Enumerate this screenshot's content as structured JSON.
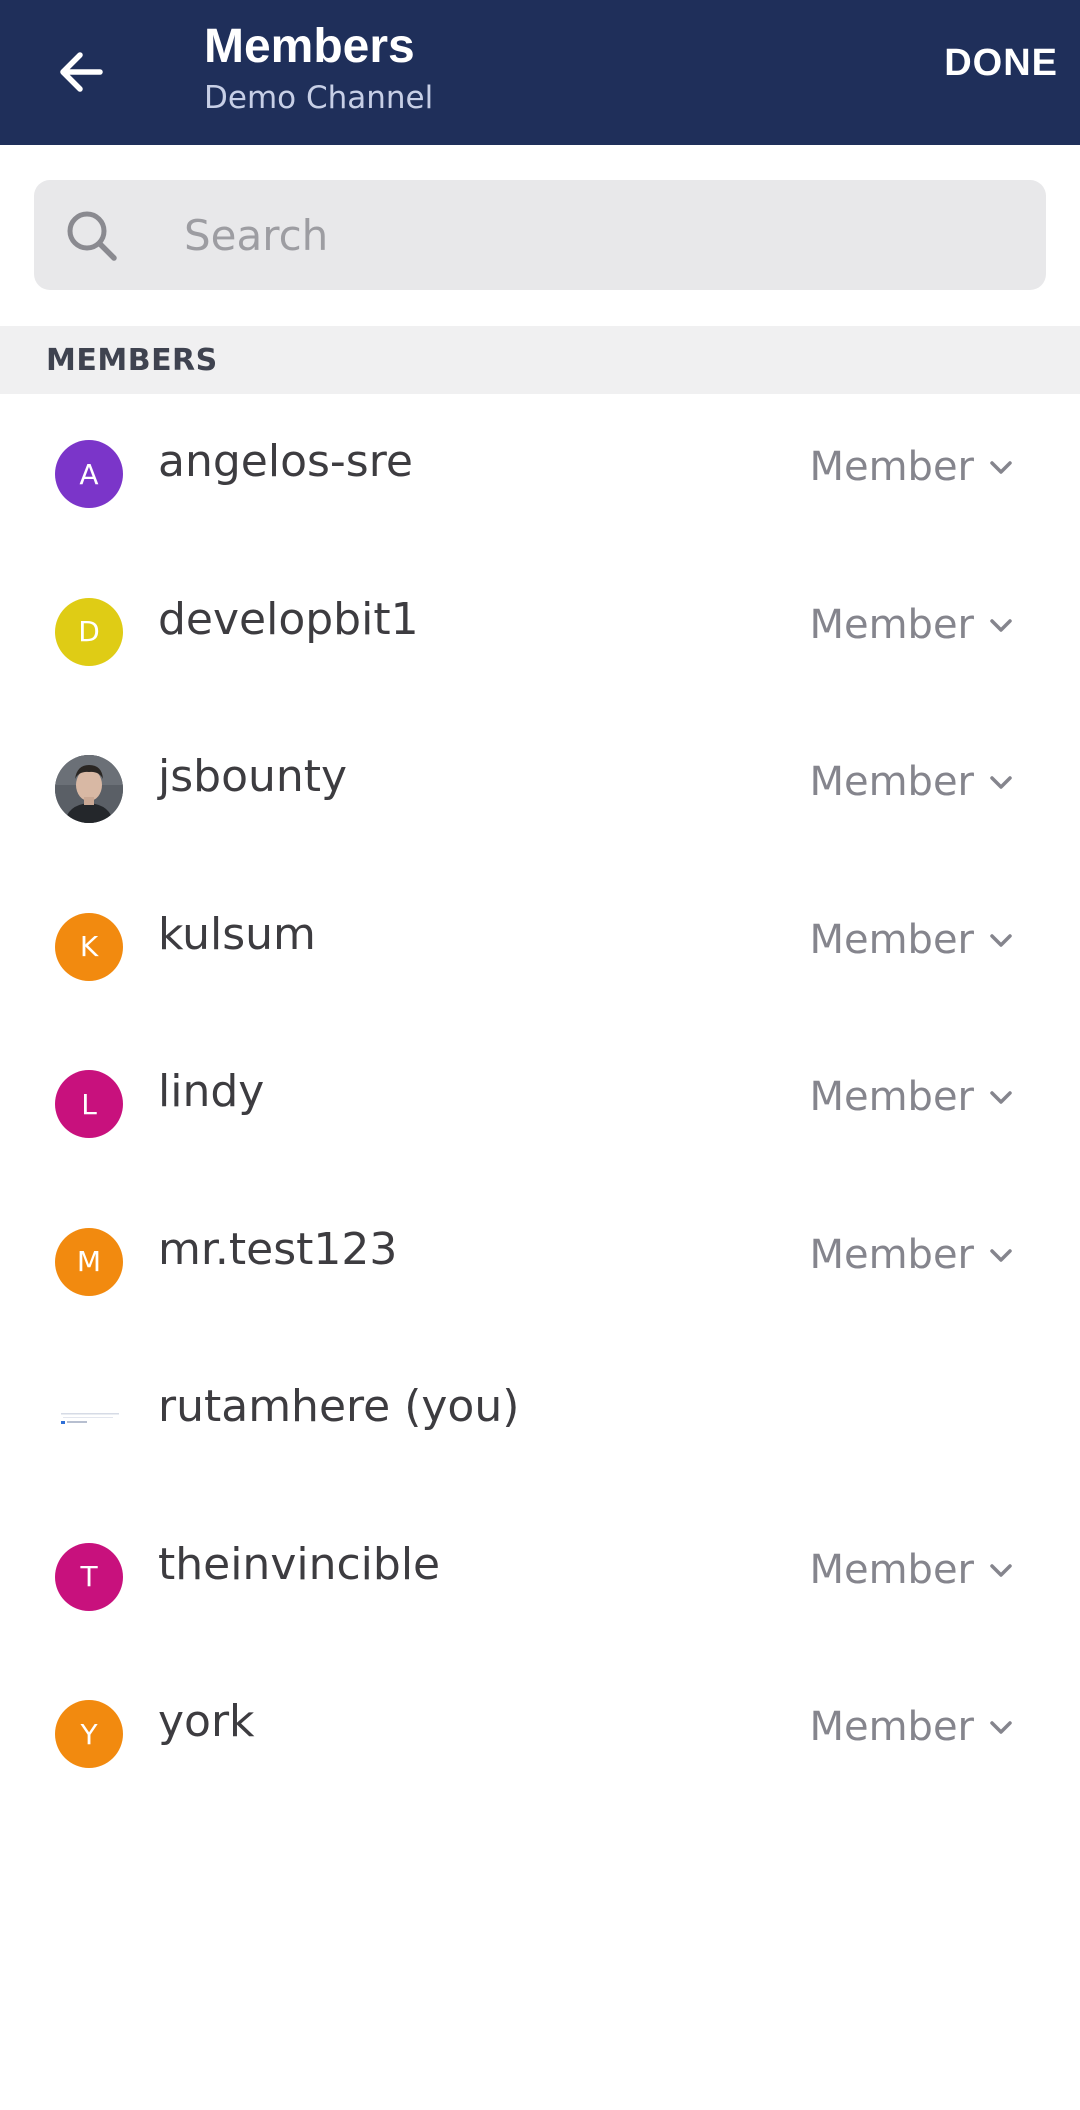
{
  "header": {
    "title": "Members",
    "subtitle": "Demo Channel",
    "done_label": "DONE",
    "back_icon": "arrow-left-icon",
    "background": "#1f2f5a"
  },
  "search": {
    "placeholder": "Search",
    "value": "",
    "icon": "search-icon"
  },
  "section": {
    "label": "MEMBERS"
  },
  "members": [
    {
      "initial": "A",
      "name": "angelos-sre",
      "role": "Member",
      "color": "#7b35c9",
      "avatar_type": "initial"
    },
    {
      "initial": "D",
      "name": "developbit1",
      "role": "Member",
      "color": "#dfcc15",
      "avatar_type": "initial"
    },
    {
      "initial": "",
      "name": "jsbounty",
      "role": "Member",
      "color": "#4a4f55",
      "avatar_type": "photo"
    },
    {
      "initial": "K",
      "name": "kulsum",
      "role": "Member",
      "color": "#f28a0f",
      "avatar_type": "initial"
    },
    {
      "initial": "L",
      "name": "lindy",
      "role": "Member",
      "color": "#c8117d",
      "avatar_type": "initial"
    },
    {
      "initial": "M",
      "name": "mr.test123",
      "role": "Member",
      "color": "#f28a0f",
      "avatar_type": "initial"
    },
    {
      "initial": "",
      "name": "rutamhere (you)",
      "role": "",
      "color": "#ffffff",
      "avatar_type": "image"
    },
    {
      "initial": "T",
      "name": "theinvincible",
      "role": "Member",
      "color": "#c8117d",
      "avatar_type": "initial"
    },
    {
      "initial": "Y",
      "name": "york",
      "role": "Member",
      "color": "#f28a0f",
      "avatar_type": "initial"
    }
  ]
}
